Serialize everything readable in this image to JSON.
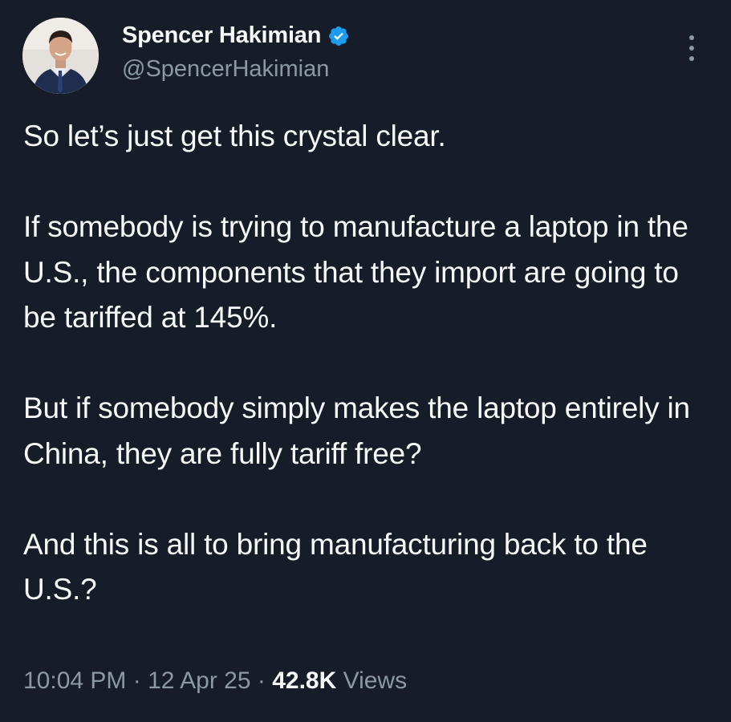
{
  "author": {
    "display_name": "Spencer Hakimian",
    "handle": "@SpencerHakimian",
    "verified": true,
    "verified_color": "#1d9bf0"
  },
  "icons": {
    "verified": "verified-badge-icon",
    "more": "more-options-icon"
  },
  "tweet": {
    "paragraphs": [
      "So let’s just get this crystal clear.",
      "If somebody is trying to manufacture a laptop in the U.S., the components that they import are going to be tariffed at 145%.",
      "But if somebody simply makes the laptop entirely in China, they are fully tariff free?",
      "And this is all to bring manufacturing back to the U.S.?"
    ]
  },
  "meta": {
    "time": "10:04 PM",
    "date": "12 Apr 25",
    "separator": " · ",
    "views_count": "42.8K",
    "views_label": " Views"
  },
  "colors": {
    "background": "#161c28",
    "text": "#f7f9f9",
    "secondary_text": "#8b98a5"
  }
}
